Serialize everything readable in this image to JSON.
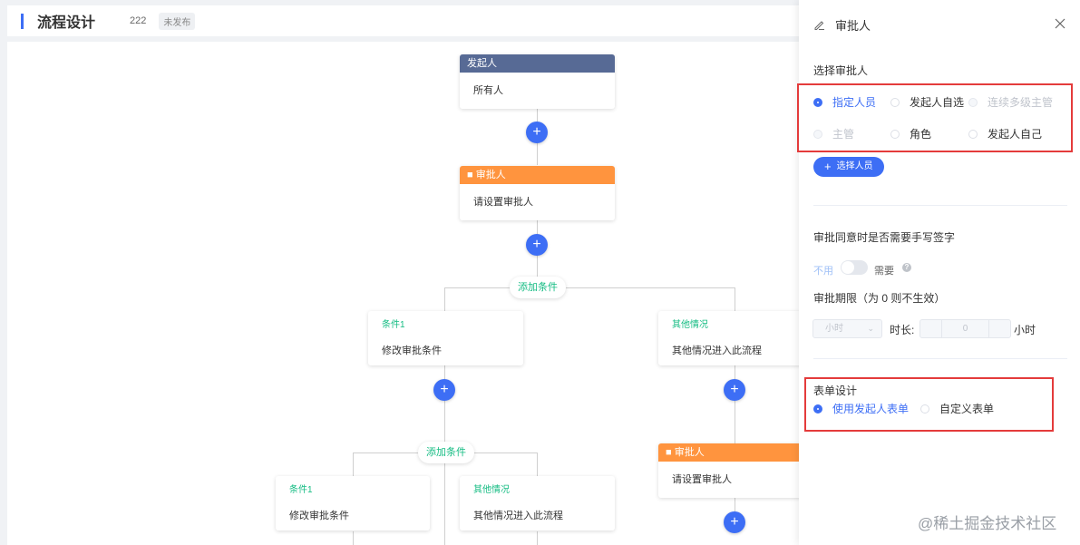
{
  "header": {
    "title": "流程设计",
    "version": "222",
    "status": "未发布"
  },
  "flow": {
    "starter": {
      "head": "发起人",
      "body": "所有人"
    },
    "approver1": {
      "head": "审批人",
      "body": "请设置审批人"
    },
    "add_condition_1": "添加条件",
    "branch_left": {
      "title": "条件1",
      "body": "修改审批条件"
    },
    "branch_right": {
      "title": "其他情况",
      "body": "其他情况进入此流程"
    },
    "add_condition_2": "添加条件",
    "sub_left": {
      "title": "条件1",
      "body": "修改审批条件"
    },
    "sub_right": {
      "title": "其他情况",
      "body": "其他情况进入此流程"
    },
    "approver2": {
      "head": "审批人",
      "body": "请设置审批人"
    },
    "plus": "+"
  },
  "panel": {
    "title": "审批人",
    "select_label": "选择审批人",
    "options": {
      "designated": "指定人员",
      "self_select": "发起人自选",
      "multi_level": "连续多级主管",
      "manager": "主管",
      "role": "角色",
      "initiator_self": "发起人自己"
    },
    "select_button": "选择人员",
    "signature_label": "审批同意时是否需要手写签字",
    "toggle_off": "不用",
    "toggle_on": "需要",
    "deadline_label": "审批期限（为 0 则不生效）",
    "unit_select": "小时",
    "duration_label": "时长:",
    "duration_value": "0",
    "duration_unit": "小时",
    "form_label": "表单设计",
    "form_options": {
      "use_initiator": "使用发起人表单",
      "custom": "自定义表单"
    }
  },
  "watermark": "@稀土掘金技术社区",
  "colors": {
    "accent": "#3d6ef5",
    "starter": "#576a95",
    "approver": "#ff943e",
    "condition": "#15bc83",
    "highlight": "#e43b3b"
  }
}
